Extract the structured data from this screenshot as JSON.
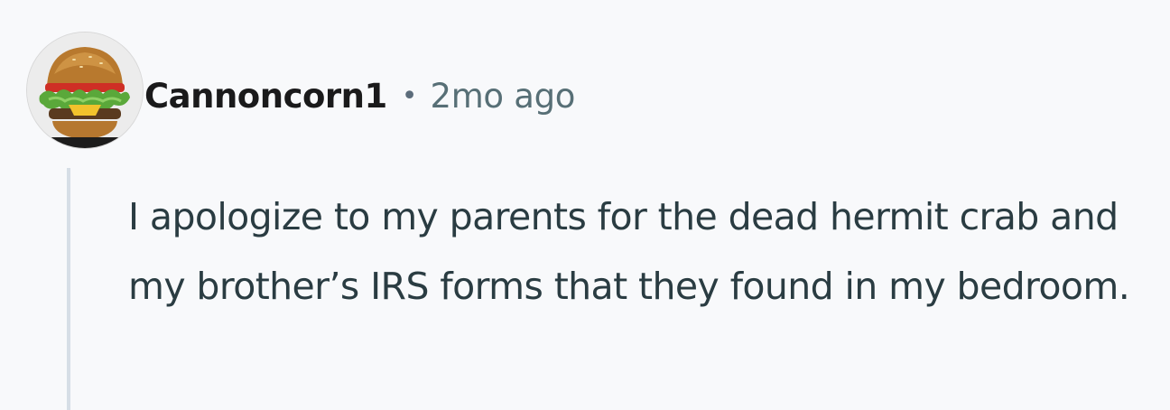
{
  "comment": {
    "author": {
      "username": "Cannoncorn1",
      "avatar_icon": "burger-avatar-icon"
    },
    "separator": "•",
    "timestamp": "2mo ago",
    "body": "I apologize to my parents for the dead hermit crab and my brother’s IRS forms that they found in my bedroom."
  },
  "colors": {
    "background": "#f8f9fb",
    "username": "#1a1a1b",
    "meta": "#576f76",
    "body": "#2a3c42",
    "thread_line": "#d6dee6"
  }
}
